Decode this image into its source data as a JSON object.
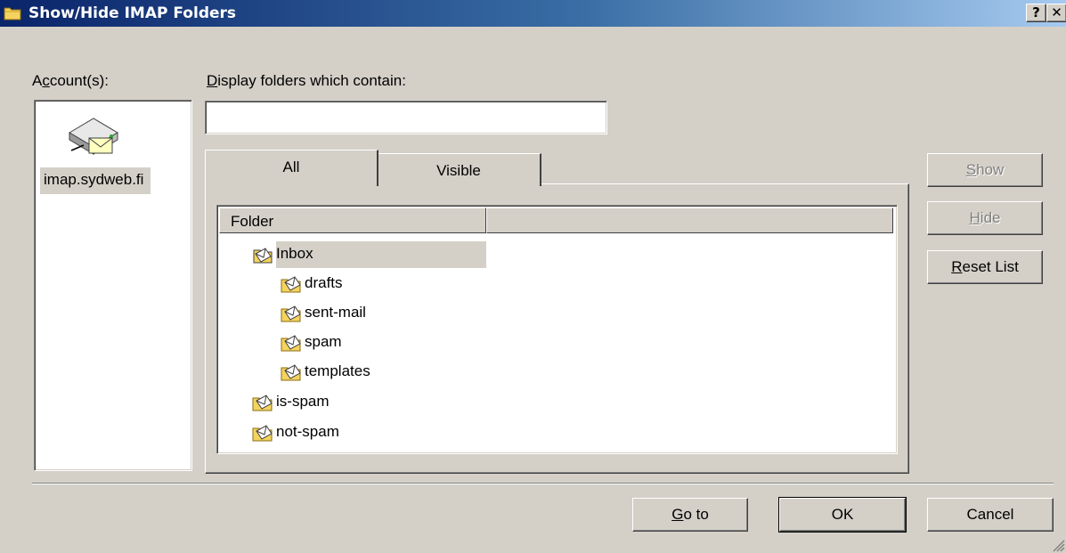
{
  "window": {
    "title": "Show/Hide IMAP Folders",
    "help_glyph": "?",
    "close_glyph": "✕",
    "colors": {
      "titlebar_start": "#0a246a",
      "titlebar_end": "#a6caf0",
      "face": "#d4d0c8"
    }
  },
  "accounts": {
    "label_pre": "A",
    "label_mnemonic": "c",
    "label_post": "count(s):",
    "items": [
      {
        "label": "imap.sydweb.fi",
        "icon": "mail-server-icon",
        "selected": true
      }
    ]
  },
  "filter": {
    "label_mnemonic": "D",
    "label_rest": "isplay folders which contain:",
    "value": "",
    "placeholder": ""
  },
  "tabs": [
    {
      "label": "All",
      "active": true
    },
    {
      "label": "Visible",
      "active": false
    }
  ],
  "folder_list": {
    "columns": [
      "Folder",
      ""
    ],
    "rows": [
      {
        "label": "Inbox",
        "level": 1,
        "icon": "inbox-folder-icon",
        "selected": true
      },
      {
        "label": "drafts",
        "level": 2,
        "icon": "mail-folder-icon"
      },
      {
        "label": "sent-mail",
        "level": 2,
        "icon": "mail-folder-icon"
      },
      {
        "label": "spam",
        "level": 2,
        "icon": "mail-folder-icon"
      },
      {
        "label": "templates",
        "level": 2,
        "icon": "mail-folder-icon"
      },
      {
        "label": "is-spam",
        "level": 1,
        "icon": "mail-folder-icon"
      },
      {
        "label": "not-spam",
        "level": 1,
        "icon": "mail-folder-icon"
      }
    ]
  },
  "side_buttons": {
    "show": {
      "mnemonic": "S",
      "rest": "how",
      "enabled": false
    },
    "hide": {
      "mnemonic": "H",
      "rest": "ide",
      "enabled": false
    },
    "reset": {
      "mnemonic": "R",
      "rest": "eset List",
      "enabled": true
    }
  },
  "footer_buttons": {
    "goto": {
      "mnemonic": "G",
      "rest": "o to"
    },
    "ok": {
      "label": "OK"
    },
    "cancel": {
      "label": "Cancel"
    }
  }
}
